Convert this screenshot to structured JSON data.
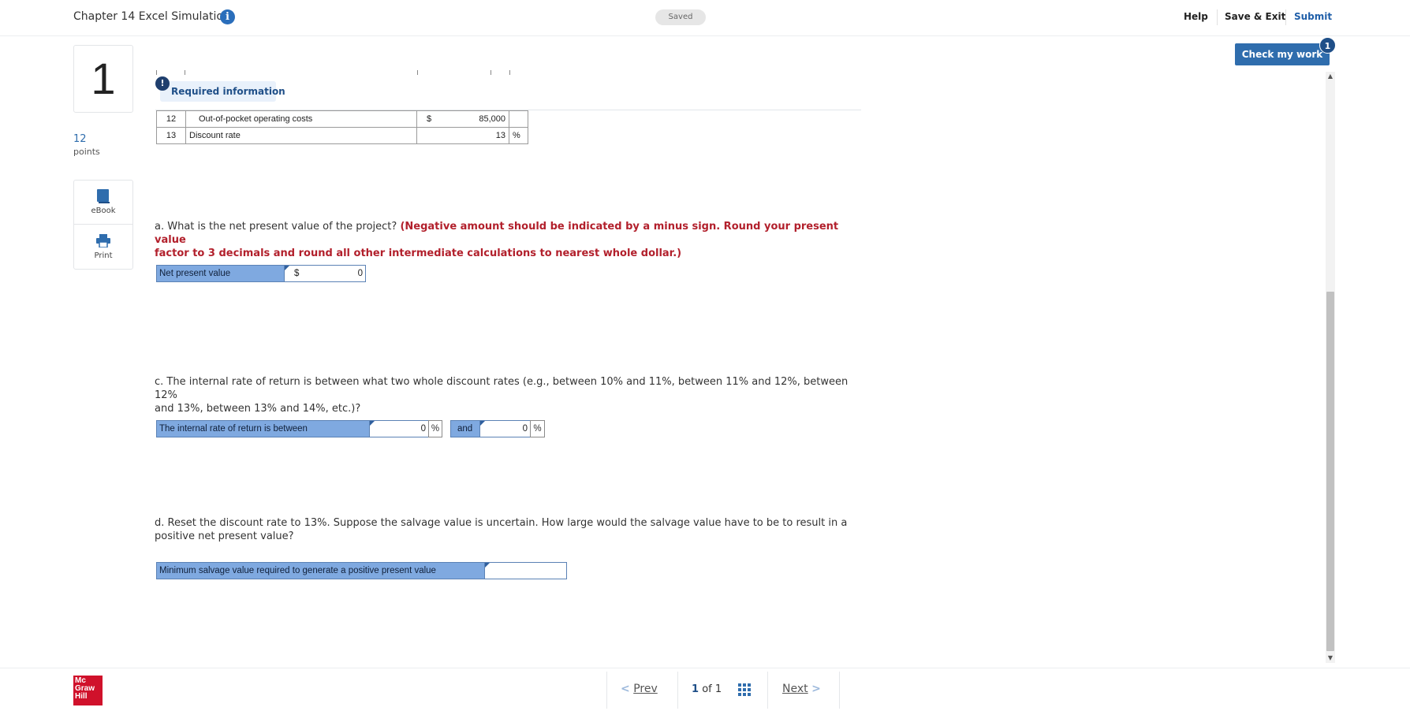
{
  "header": {
    "title": "Chapter 14 Excel Simulation",
    "info_icon": "i",
    "status": "Saved",
    "links": {
      "help": "Help",
      "save_exit": "Save & Exit",
      "submit": "Submit"
    }
  },
  "check_work": {
    "label": "Check my work",
    "badge": "1"
  },
  "question": {
    "number": "1",
    "points_value": "12",
    "points_label": "points"
  },
  "tools": {
    "ebook_label": "eBook",
    "print_label": "Print"
  },
  "required": {
    "label": "Required information",
    "icon": "!"
  },
  "info_table": {
    "rows": [
      {
        "row": "12",
        "label": "Out-of-pocket operating costs",
        "symbol": "$",
        "value": "85,000",
        "suffix": ""
      },
      {
        "row": "13",
        "label": "Discount rate",
        "symbol": "",
        "value": "13",
        "suffix": "%"
      }
    ]
  },
  "part_a": {
    "prompt": "a. What is the net present value of the project?",
    "instruction_line1": "(Negative amount should be indicated by a minus sign. Round your present value",
    "instruction_line2": "factor to 3 decimals and round all other intermediate calculations to nearest whole dollar.)",
    "label": "Net present value",
    "currency": "$",
    "value": "0"
  },
  "part_c": {
    "prompt_line1": "c. The internal rate of return is between what two whole discount rates (e.g., between 10% and 11%, between 11% and 12%, between 12%",
    "prompt_line2": "and 13%, between 13% and 14%, etc.)?",
    "label": "The internal rate of return is between",
    "value1": "0",
    "pct": "%",
    "and_label": "and",
    "value2": "0"
  },
  "part_d": {
    "prompt_line1": "d. Reset the discount rate to 13%. Suppose the salvage value is uncertain. How large would the salvage value have to be to result in a",
    "prompt_line2": "positive net present value?",
    "label": "Minimum salvage value required to generate a positive present value",
    "value": ""
  },
  "footer": {
    "logo_line1": "Mc",
    "logo_line2": "Graw",
    "logo_line3": "Hill",
    "prev": "Prev",
    "page_current": "1",
    "page_of": "of",
    "page_total": "1",
    "next": "Next"
  }
}
